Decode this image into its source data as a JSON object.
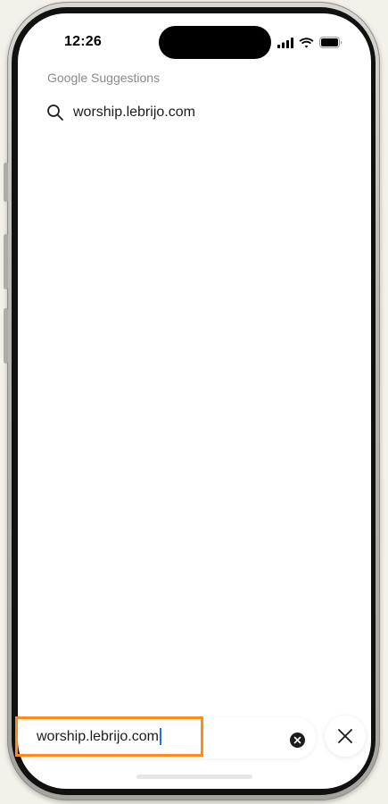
{
  "status_bar": {
    "time": "12:26",
    "icons": [
      "cellular-signal-icon",
      "wifi-icon",
      "battery-icon"
    ]
  },
  "suggestions": {
    "header": "Google Suggestions",
    "items": [
      {
        "icon": "search-icon",
        "text": "worship.lebrijo.com"
      }
    ]
  },
  "address_bar": {
    "value": "worship.lebrijo.com",
    "clear_icon": "clear-icon",
    "close_icon": "close-icon"
  },
  "colors": {
    "highlight": "#ff8c1a",
    "caret": "#1a73e8",
    "header_text": "#8a8a8e"
  }
}
